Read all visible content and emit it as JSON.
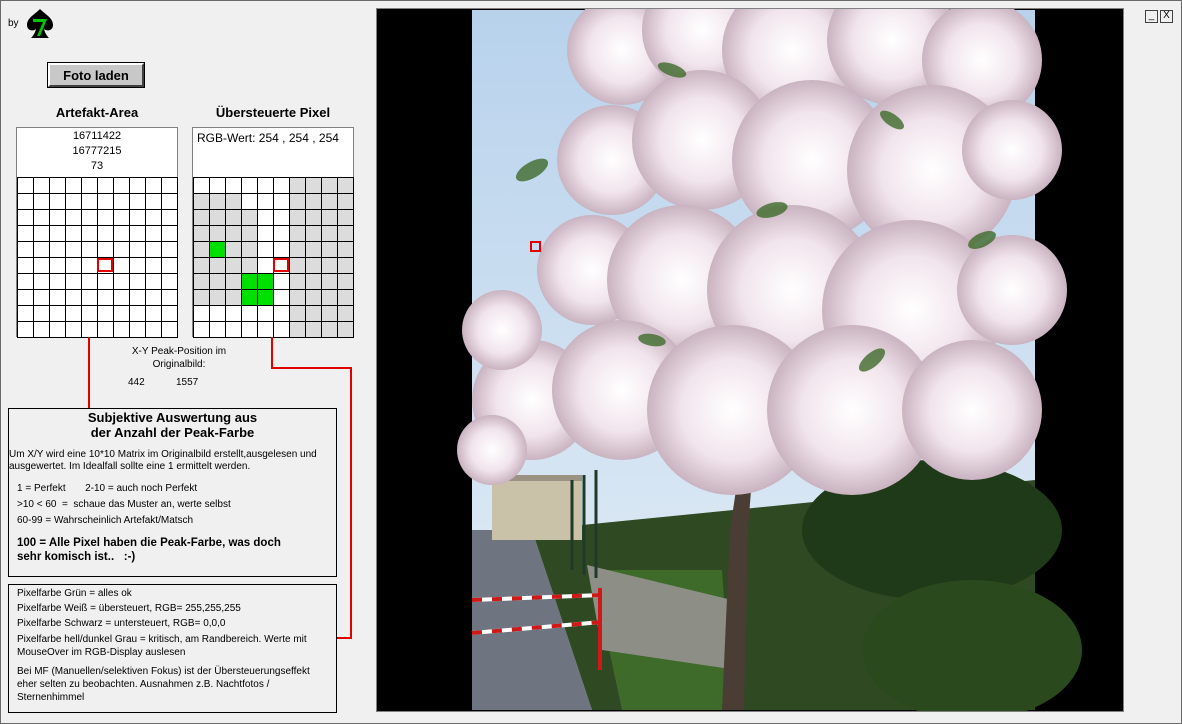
{
  "app": {
    "by_label": "by",
    "load_button": "Foto laden"
  },
  "artefakt": {
    "heading": "Artefakt-Area",
    "values": [
      "16711422",
      "16777215",
      "73"
    ],
    "grid": [
      "wwwwwwwwww",
      "wwwwwwwwww",
      "wwwwwwwwww",
      "wwwwwwwwww",
      "wwwwwwwwww",
      "wwwwwwwwww",
      "wwwwwwwwww",
      "wwwwwwwwww",
      "wwwwwwwwww",
      "wwwwwwwwww"
    ]
  },
  "uebersteuert": {
    "heading": "Übersteuerte Pixel",
    "rgb_label": "RGB-Wert:",
    "r": "254",
    "g": "254",
    "b": "254",
    "sep": ",",
    "grid": [
      "wwwwwwgggg",
      "gggwwwgggg",
      "ggggwwgggg",
      "ggggwwgggg",
      "gGggwwgggg",
      "ggggwwgggg",
      "gggGGwgggg",
      "gggGGwgggg",
      "wwwwwwgggg",
      "wwwwwwgggg"
    ]
  },
  "peak": {
    "label_line1": "X-Y Peak-Position  im",
    "label_line2": "Originalbild:",
    "x": "442",
    "y": "1557"
  },
  "auswertung": {
    "title_line1": "Subjektive Auswertung aus",
    "title_line2": "der Anzahl der Peak-Farbe",
    "lines": [
      "Um X/Y wird eine 10*10 Matrix im Originalbild erstellt,ausgelesen und",
      "ausgewertet. Im Idealfall sollte eine 1 ermittelt werden."
    ],
    "scale": [
      "1 = Perfekt       2-10 = auch noch Perfekt",
      ">10 < 60  =  schaue das Muster an, werte selbst",
      "60-99 = Wahrscheinlich Artefakt/Matsch"
    ],
    "bold_line1": "100 = Alle Pixel haben die Peak-Farbe, was doch",
    "bold_line2": "sehr komisch ist..   :-)"
  },
  "legende": {
    "lines": [
      "Pixelfarbe Grün = alles ok",
      "Pixelfarbe Weiß = übersteuert, RGB= 255,255,255",
      "Pixelfarbe Schwarz = untersteuert, RGB= 0,0,0",
      "Pixelfarbe hell/dunkel Grau = kritisch, am Randbereich. Werte mit",
      "MouseOver im RGB-Display auslesen",
      "Bei MF (Manuellen/selektiven Fokus) ist der Übersteuerungseffekt",
      "eher selten zu beobachten. Ausnahmen z.B. Nachtfotos /",
      "Sternenhimmel"
    ]
  },
  "window": {
    "minimize": "_",
    "close": "X"
  },
  "colors": {
    "green": "#00e000",
    "gray": "#dcdcdc",
    "marker": "#e00000",
    "sky": "#c8dcef",
    "blossom": "#f2e8ee"
  }
}
